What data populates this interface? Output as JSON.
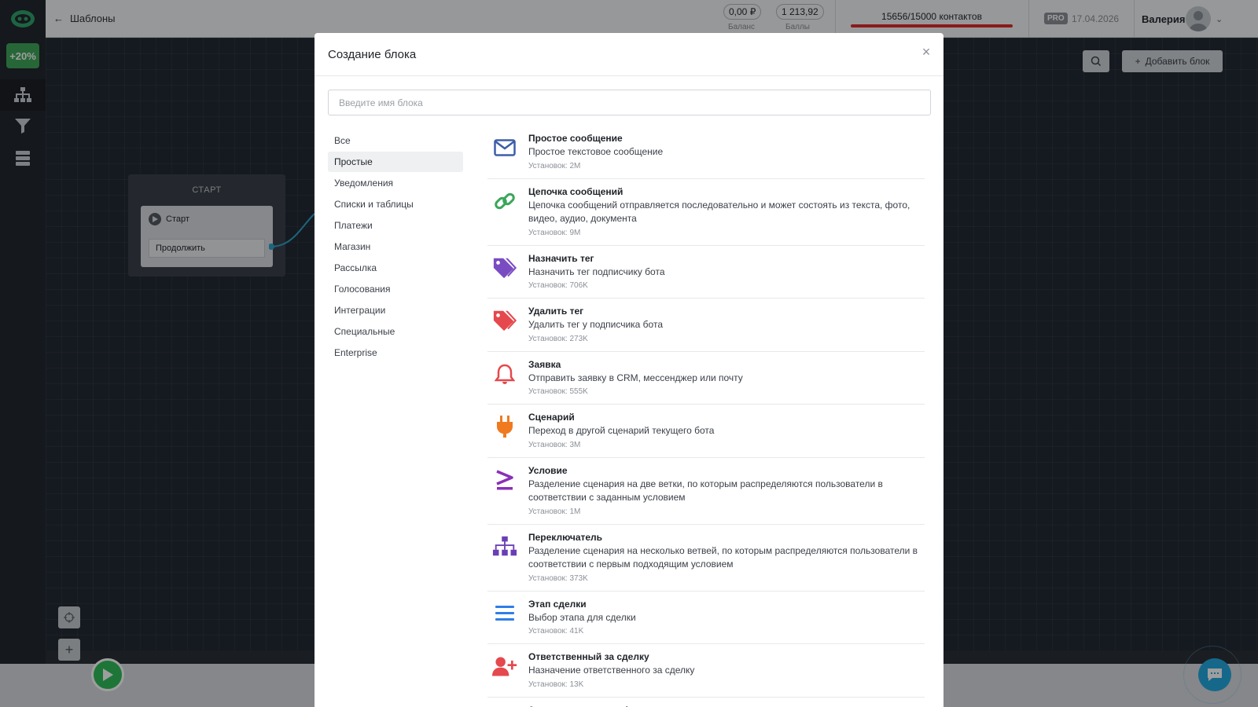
{
  "app": {
    "promo_label": "+20%",
    "back_label": "Шаблоны",
    "balance": {
      "value": "0,00 ₽",
      "caption": "Баланс"
    },
    "points": {
      "value": "1 213,92",
      "caption": "Баллы"
    },
    "contacts_text": "15656/15000 контактов",
    "plan_badge": "PRO",
    "plan_date": "17.04.2026",
    "user_name": "Валерия",
    "add_block_label": "Добавить блок"
  },
  "canvas": {
    "start_node_title": "СТАРТ",
    "start_label": "Старт",
    "continue_label": "Продолжить"
  },
  "modal": {
    "title": "Создание блока",
    "search_placeholder": "Введите имя блока",
    "categories": [
      "Все",
      "Простые",
      "Уведомления",
      "Списки и таблицы",
      "Платежи",
      "Магазин",
      "Рассылка",
      "Голосования",
      "Интеграции",
      "Специальные",
      "Enterprise"
    ],
    "active_category": "Простые",
    "blocks": [
      {
        "icon": "envelope-icon",
        "color": "#3d5ea8",
        "title": "Простое сообщение",
        "desc": "Простое текстовое сообщение",
        "installs": "Установок: 2M"
      },
      {
        "icon": "link-icon",
        "color": "#3aa65a",
        "title": "Цепочка сообщений",
        "desc": "Цепочка сообщений отправляется последовательно и может состоять из текста, фото, видео, аудио, документа",
        "installs": "Установок: 9M"
      },
      {
        "icon": "tags-icon",
        "color": "#7a4cc2",
        "title": "Назначить тег",
        "desc": "Назначить тег подписчику бота",
        "installs": "Установок: 706K"
      },
      {
        "icon": "tags-icon",
        "color": "#e5484d",
        "title": "Удалить тег",
        "desc": "Удалить тег у подписчика бота",
        "installs": "Установок: 273K"
      },
      {
        "icon": "bell-icon",
        "color": "#e5484d",
        "title": "Заявка",
        "desc": "Отправить заявку в CRM, мессенджер или почту",
        "installs": "Установок: 555K"
      },
      {
        "icon": "plug-icon",
        "color": "#f07a20",
        "title": "Сценарий",
        "desc": "Переход в другой сценарий текущего бота",
        "installs": "Установок: 3M"
      },
      {
        "icon": "greater-equal-icon",
        "color": "#8b2fb8",
        "title": "Условие",
        "desc": "Разделение сценария на две ветки, по которым распределяются пользователи в соответствии с заданным условием",
        "installs": "Установок: 1M"
      },
      {
        "icon": "sitemap-icon",
        "color": "#6a3fb5",
        "title": "Переключатель",
        "desc": "Разделение сценария на несколько ветвей, по которым распределяются пользователи в соответствии с первым подходящим условием",
        "installs": "Установок: 373K"
      },
      {
        "icon": "list-icon",
        "color": "#2f7ee6",
        "title": "Этап сделки",
        "desc": "Выбор этапа для сделки",
        "installs": "Установок: 41K"
      },
      {
        "icon": "user-plus-icon",
        "color": "#e5484d",
        "title": "Ответственный за сделку",
        "desc": "Назначение ответственного за сделку",
        "installs": "Установок: 13K"
      },
      {
        "icon": "phone-icon",
        "color": "#1f2328",
        "title": "Запрос номера телефона",
        "desc": "",
        "installs": ""
      }
    ]
  }
}
